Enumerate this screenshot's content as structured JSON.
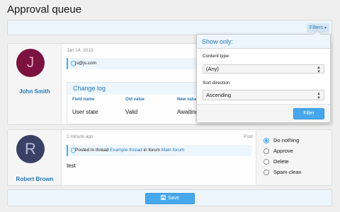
{
  "page": {
    "title": "Approval queue"
  },
  "filter_bar": {
    "filters_label": "Filters"
  },
  "items": [
    {
      "avatar_letter": "J",
      "username": "John Smith",
      "date": "Jan 14, 2019",
      "info": "js@js.com",
      "changelog": {
        "title": "Change log",
        "columns": [
          "Field name",
          "Old value",
          "New value"
        ],
        "rows": [
          [
            "User state",
            "Valid",
            "Awaiting a"
          ]
        ]
      }
    },
    {
      "avatar_letter": "R",
      "username": "Robert Brown",
      "date": "1 minute ago",
      "type_label": "Post",
      "info_prefix": "Posted in thread",
      "thread_link": "Example thread",
      "info_mid": "in forum",
      "forum_link": "Main forum",
      "message": "test",
      "actions": [
        "Do nothing",
        "Approve",
        "Delete",
        "Spam clean"
      ],
      "selected_action": "Do nothing"
    }
  ],
  "filter_popup": {
    "title": "Show only:",
    "content_type_label": "Content type:",
    "content_type_value": "(Any)",
    "sort_label": "Sort direction:",
    "sort_value": "Ascending",
    "submit_label": "Filter"
  },
  "footer": {
    "save_label": "Save"
  },
  "colors": {
    "accent": "#47a7eb",
    "link": "#2577b1",
    "highlight_bg": "#edf6fd",
    "avatar_j": "#7b1240",
    "avatar_r": "#3a4167"
  },
  "icons": {
    "info": "shield-icon",
    "save": "save-icon",
    "dropdown": "caret-down-icon",
    "select": "updown-arrows-icon"
  }
}
